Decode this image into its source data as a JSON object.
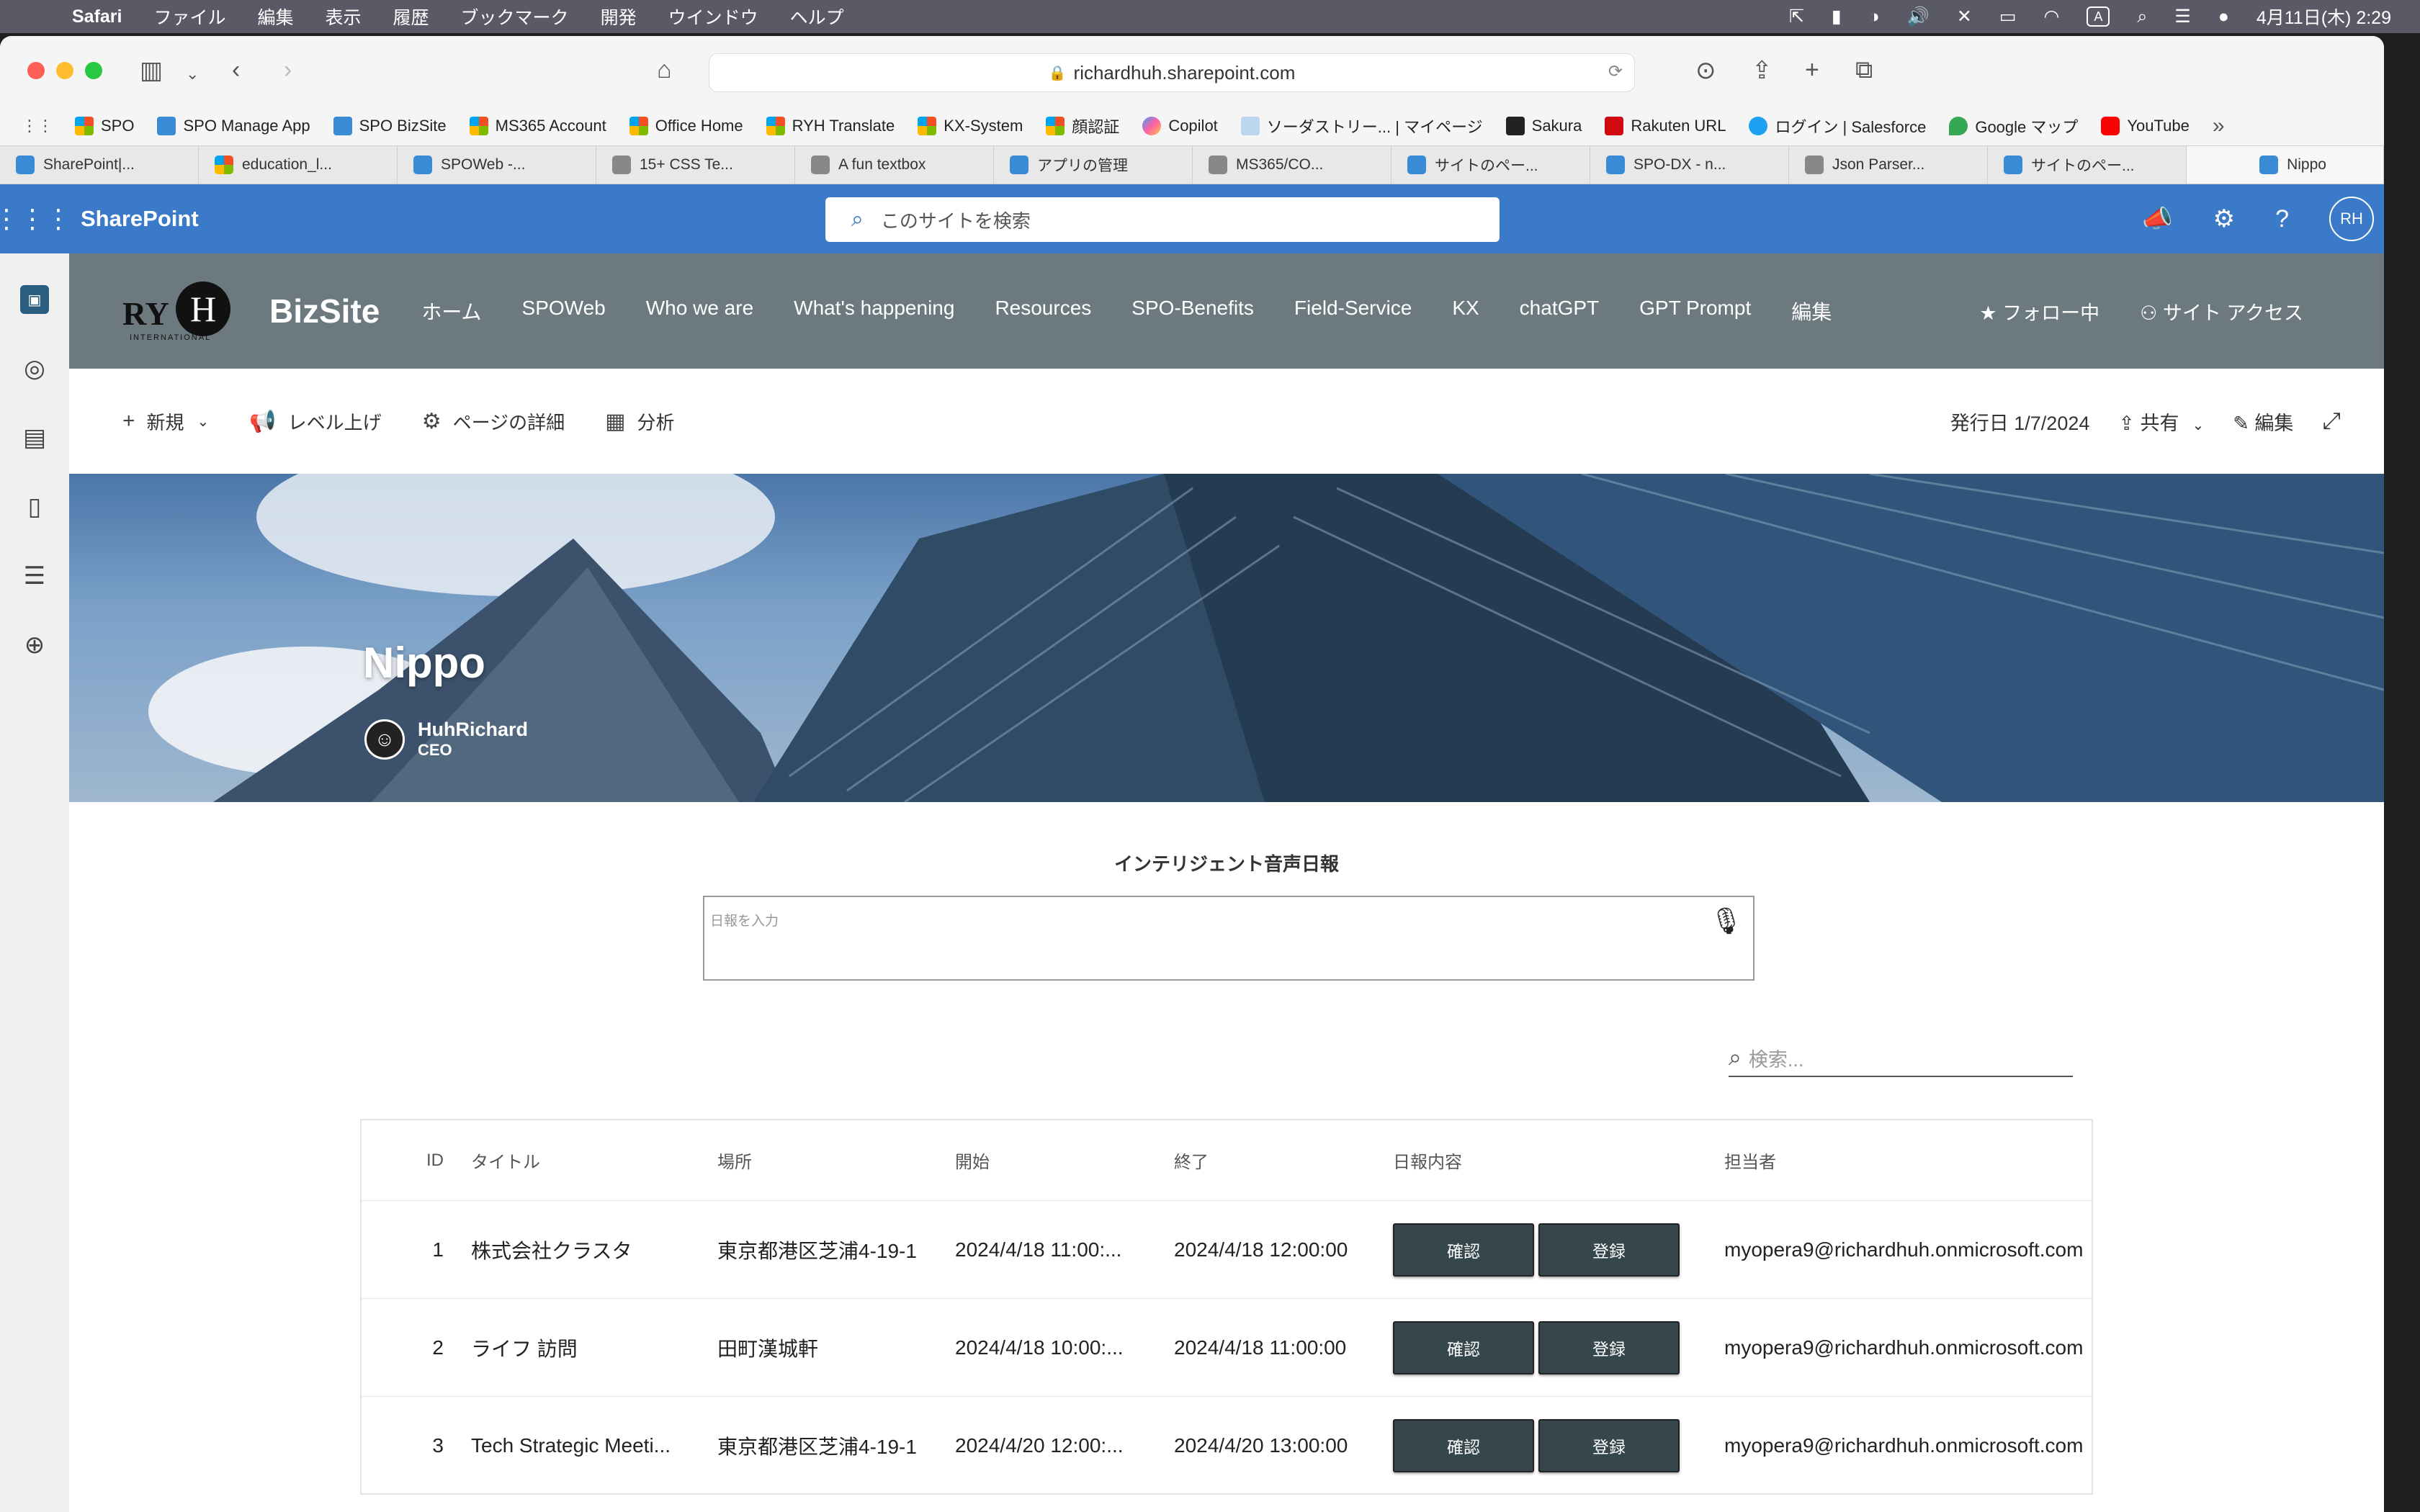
{
  "menubar": {
    "app": "Safari",
    "items": [
      "ファイル",
      "編集",
      "表示",
      "履歴",
      "ブックマーク",
      "開発",
      "ウインドウ",
      "ヘルプ"
    ],
    "clock": "4月11日(木) 2:29"
  },
  "browser": {
    "url": "richardhuh.sharepoint.com",
    "bookmarks": [
      {
        "label": "SPO",
        "icon": "ms"
      },
      {
        "label": "SPO Manage App",
        "icon": "sp"
      },
      {
        "label": "SPO BizSite",
        "icon": "sp"
      },
      {
        "label": "MS365 Account",
        "icon": "ms"
      },
      {
        "label": "Office Home",
        "icon": "ms"
      },
      {
        "label": "RYH Translate",
        "icon": "ms"
      },
      {
        "label": "KX-System",
        "icon": "ms"
      },
      {
        "label": "顔認証",
        "icon": "ms"
      },
      {
        "label": "Copilot",
        "icon": "copilot"
      },
      {
        "label": "ソーダストリー... | マイページ",
        "icon": "cup"
      },
      {
        "label": "Sakura",
        "icon": "dark"
      },
      {
        "label": "Rakuten URL",
        "icon": "red"
      },
      {
        "label": "ログイン | Salesforce",
        "icon": "sf"
      },
      {
        "label": "Google マップ",
        "icon": "gmap"
      },
      {
        "label": "YouTube",
        "icon": "yt"
      }
    ],
    "tabs": [
      {
        "label": "SharePoint|...",
        "icon": "sp"
      },
      {
        "label": "education_l...",
        "icon": "ms"
      },
      {
        "label": "SPOWeb -...",
        "icon": "sp"
      },
      {
        "label": "15+ CSS Te...",
        "icon": "gray"
      },
      {
        "label": "A fun textbox",
        "icon": "gray"
      },
      {
        "label": "アプリの管理",
        "icon": "sp"
      },
      {
        "label": "MS365/CO...",
        "icon": "gray"
      },
      {
        "label": "サイトのペー...",
        "icon": "sp"
      },
      {
        "label": "SPO-DX - n...",
        "icon": "sp"
      },
      {
        "label": "Json Parser...",
        "icon": "gray"
      },
      {
        "label": "サイトのペー...",
        "icon": "sp"
      }
    ],
    "active_tab": "Nippo"
  },
  "suitebar": {
    "app_name": "SharePoint",
    "search_placeholder": "このサイトを検索",
    "avatar": "RH"
  },
  "site": {
    "title": "BizSite",
    "nav": [
      "ホーム",
      "SPOWeb",
      "Who we are",
      "What's happening",
      "Resources",
      "SPO-Benefits",
      "Field-Service",
      "KX",
      "chatGPT",
      "GPT Prompt",
      "編集"
    ],
    "follow": "フォロー中",
    "site_access": "サイト アクセス"
  },
  "commandbar": {
    "new": "新規",
    "promote": "レベル上げ",
    "page_details": "ページの詳細",
    "analytics": "分析",
    "published": "発行日 1/7/2024",
    "share": "共有",
    "edit": "編集"
  },
  "hero": {
    "title": "Nippo",
    "author_name": "HuhRichard",
    "author_role": "CEO"
  },
  "voice": {
    "heading": "インテリジェント音声日報",
    "placeholder": "日報を入力"
  },
  "search": {
    "placeholder": "検索..."
  },
  "table": {
    "headers": [
      "ID",
      "タイトル",
      "場所",
      "開始",
      "終了",
      "日報内容",
      "担当者"
    ],
    "confirm_label": "確認",
    "register_label": "登録",
    "rows": [
      {
        "id": "1",
        "title": "株式会社クラスタ",
        "location": "東京都港区芝浦4-19-1",
        "start": "2024/4/18 11:00:...",
        "end": "2024/4/18 12:00:00",
        "owner": "myopera9@richardhuh.onmicrosoft.com"
      },
      {
        "id": "2",
        "title": "ライフ 訪問",
        "location": "田町漢城軒",
        "start": "2024/4/18 10:00:...",
        "end": "2024/4/18 11:00:00",
        "owner": "myopera9@richardhuh.onmicrosoft.com"
      },
      {
        "id": "3",
        "title": "Tech Strategic Meeti...",
        "location": "東京都港区芝浦4-19-1",
        "start": "2024/4/20 12:00:...",
        "end": "2024/4/20 13:00:00",
        "owner": "myopera9@richardhuh.onmicrosoft.com"
      }
    ]
  }
}
